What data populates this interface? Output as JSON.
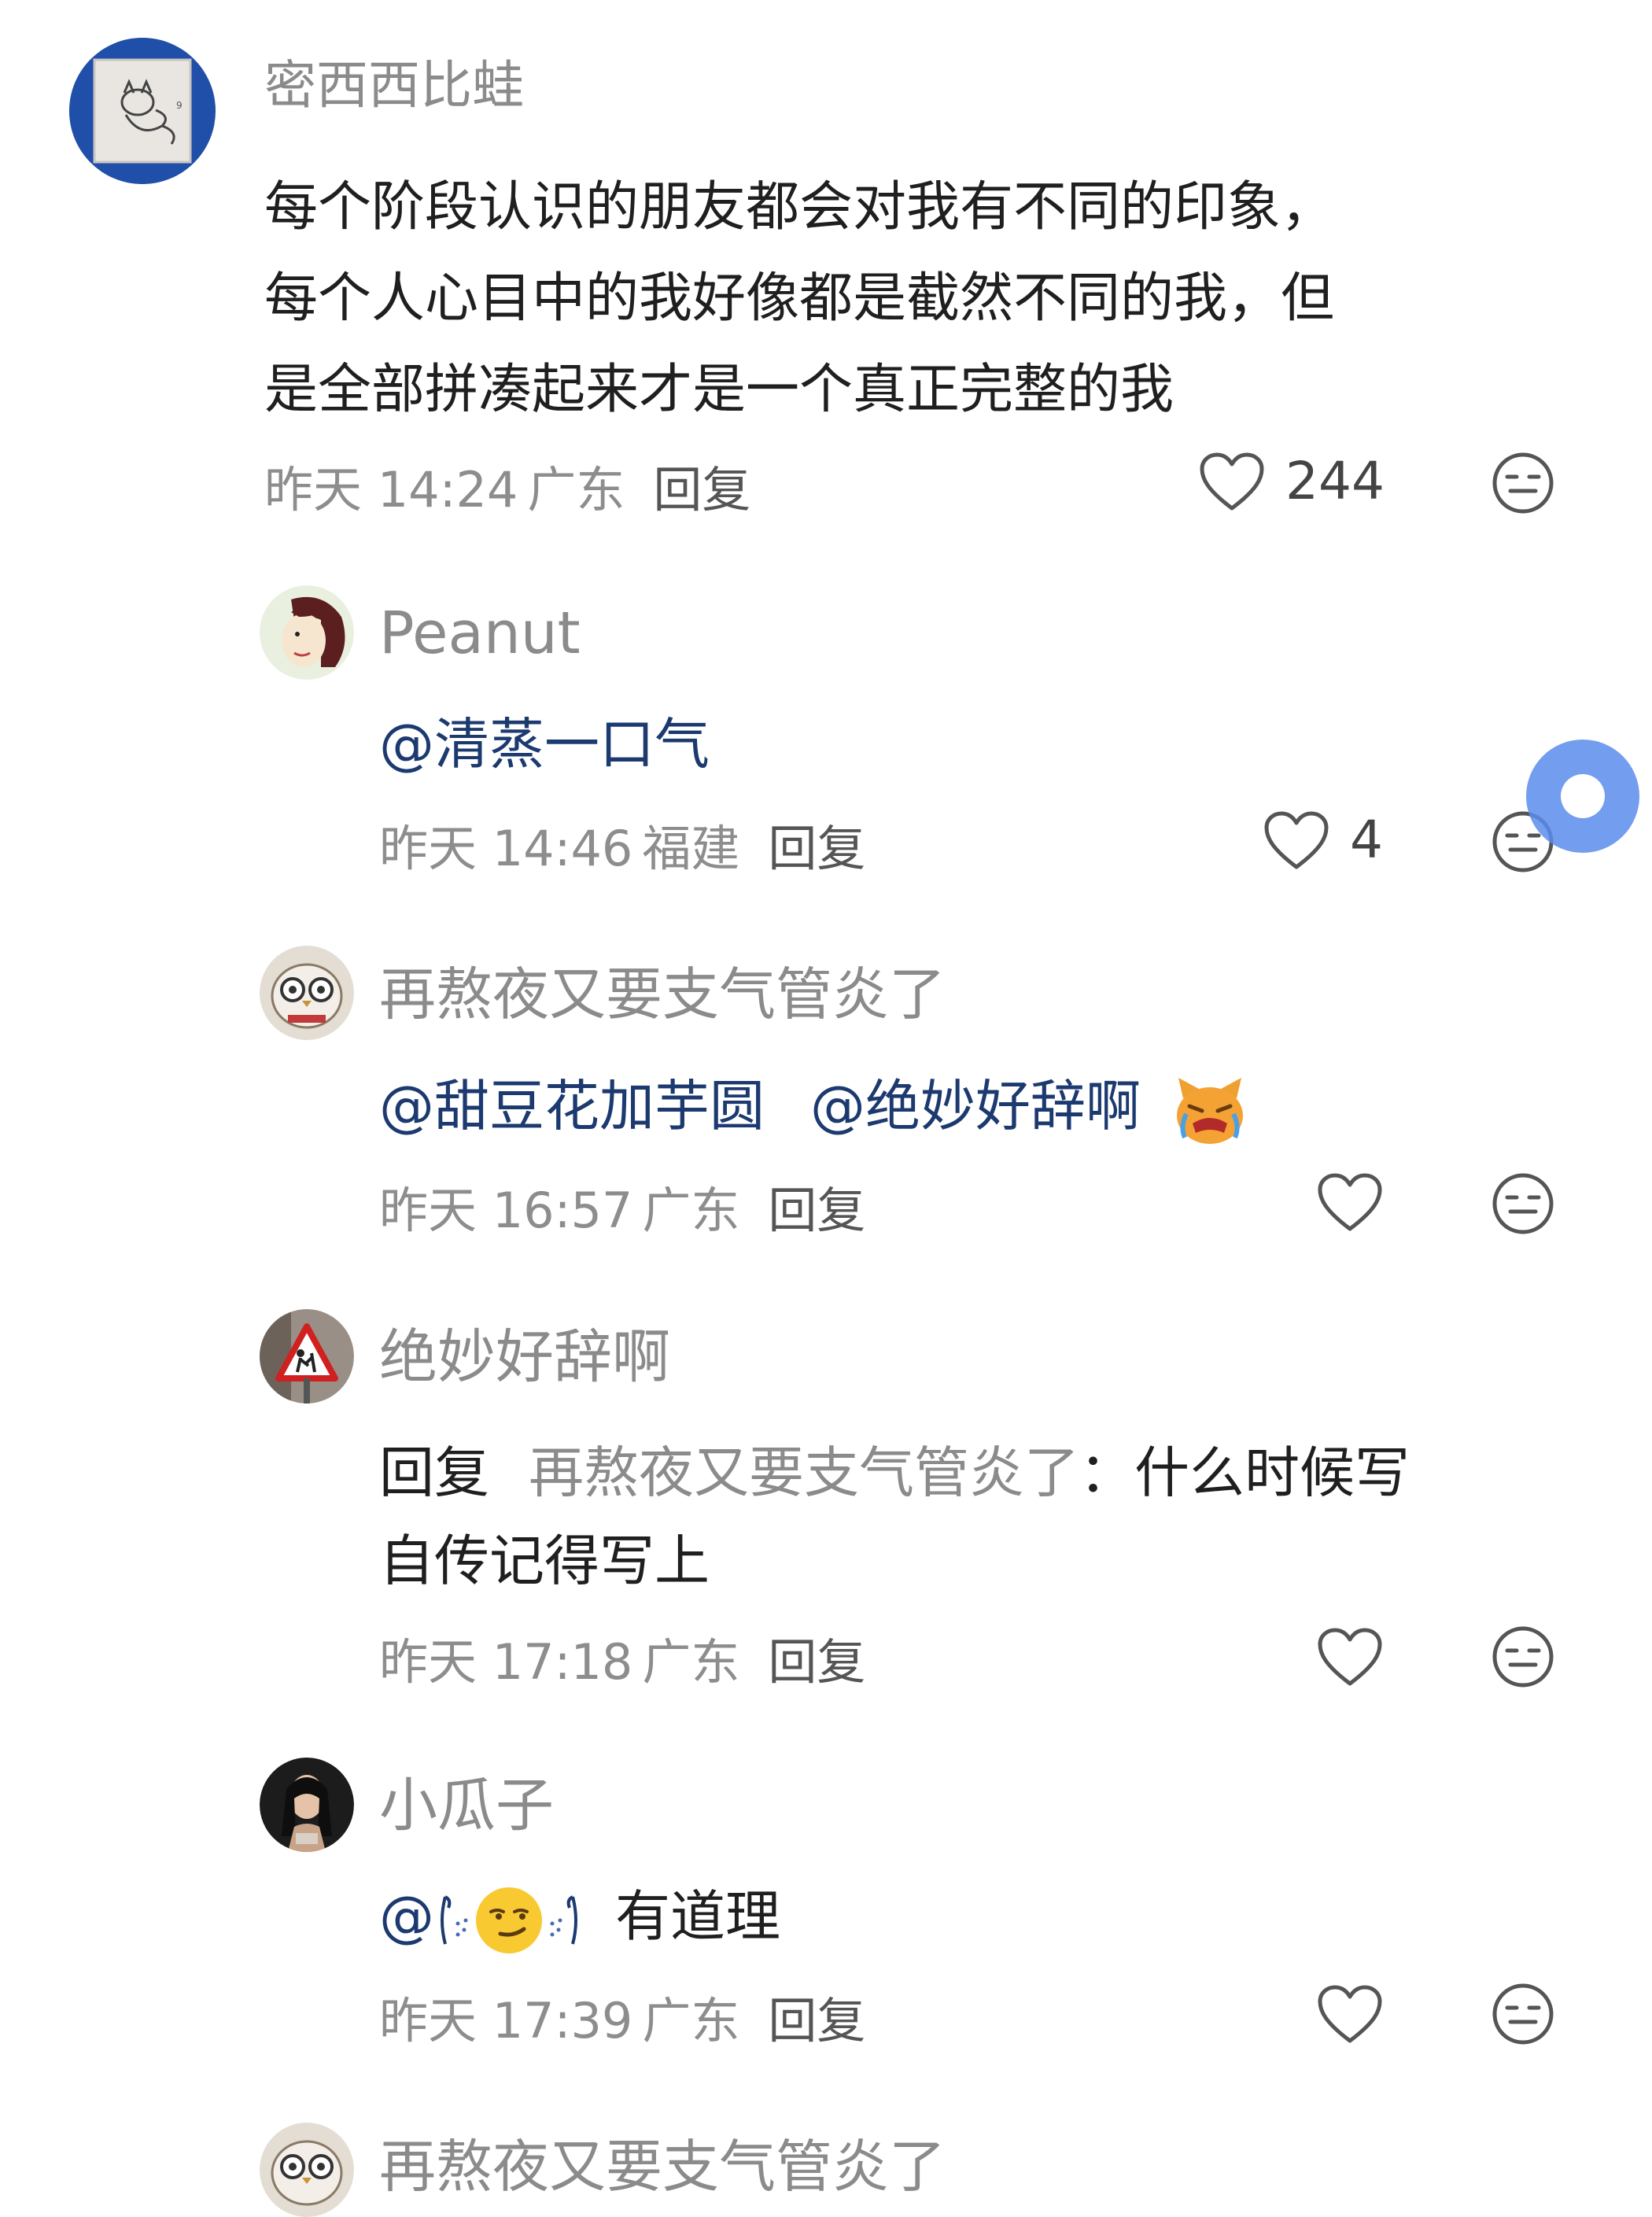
{
  "colors": {
    "username": "#8b8b8b",
    "mention": "#1c3a70",
    "meta": "#8d8d8d",
    "floating_button": "#5a8ceb"
  },
  "comments": [
    {
      "username": "密西西比蛙",
      "content_lines": [
        "每个阶段认识的朋友都会对我有不同的印象，",
        "每个人心目中的我好像都是截然不同的我，但",
        "是全部拼凑起来才是一个真正完整的我"
      ],
      "time": "昨天 14:24",
      "location": "广东",
      "reply_label": "回复",
      "like_count": "244",
      "avatar_icon": "cat-sketch-avatar"
    },
    {
      "username": "Peanut",
      "mention": "@清蒸一口气",
      "time": "昨天 14:46",
      "location": "福建",
      "reply_label": "回复",
      "like_count": "4",
      "avatar_icon": "cartoon-girl-avatar"
    },
    {
      "username": "再熬夜又要支气管炎了",
      "mention1": "@甜豆花加芋圆",
      "mention2": "@绝妙好辞啊",
      "emoji": "crying-cat-emoji",
      "time": "昨天 16:57",
      "location": "广东",
      "reply_label": "回复",
      "like_count": "",
      "avatar_icon": "owl-cup-avatar"
    },
    {
      "username": "绝妙好辞啊",
      "reply_prefix": "回复",
      "reply_target": "再熬夜又要支气管炎了",
      "reply_colon": "：",
      "content_line1": "什么时候写",
      "content_line2": "自传记得写上",
      "time": "昨天 17:18",
      "location": "广东",
      "reply_label": "回复",
      "like_count": "",
      "avatar_icon": "warning-sign-avatar"
    },
    {
      "username": "小瓜子",
      "mention_prefix": "@",
      "emoji": "smirk-emoji",
      "text": "有道理",
      "time": "昨天 17:39",
      "location": "广东",
      "reply_label": "回复",
      "like_count": "",
      "avatar_icon": "girl-photo-avatar"
    },
    {
      "username": "再熬夜又要支气管炎了",
      "avatar_icon": "owl-cup-avatar"
    }
  ]
}
